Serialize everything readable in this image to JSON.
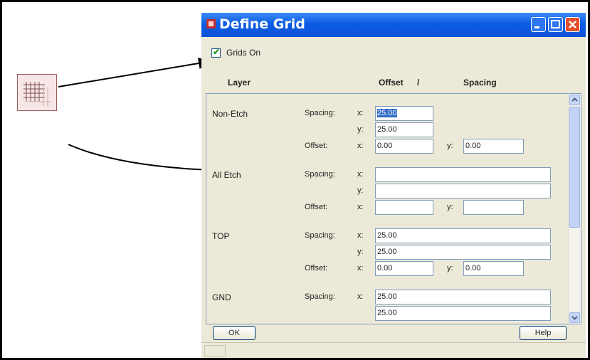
{
  "dialog": {
    "title": "Define Grid",
    "grids_on_label": "Grids On",
    "grids_on_checked": true,
    "headers": {
      "layer": "Layer",
      "offset": "Offset",
      "slash": "/",
      "spacing": "Spacing"
    },
    "labels": {
      "spacing": "Spacing:",
      "offset": "Offset:",
      "x": "x:",
      "y": "y:"
    },
    "rows": [
      {
        "name": "Non-Etch",
        "spacing_x": "25.00",
        "spacing_y": "25.00",
        "offset_x": "0.00",
        "offset_y": "0.00"
      },
      {
        "name": "All Etch",
        "spacing_x": "",
        "spacing_y": "",
        "offset_x": "",
        "offset_y": ""
      },
      {
        "name": "TOP",
        "spacing_x": "25.00",
        "spacing_y": "25.00",
        "offset_x": "0.00",
        "offset_y": "0.00"
      },
      {
        "name": "GND",
        "spacing_x": "25.00",
        "spacing_y": "25.00"
      }
    ],
    "buttons": {
      "ok": "OK",
      "help": "Help"
    }
  },
  "colors": {
    "titlebar": "#0a5ce4",
    "close": "#e2502c",
    "selection": "#316ac5",
    "check": "#21a121"
  }
}
